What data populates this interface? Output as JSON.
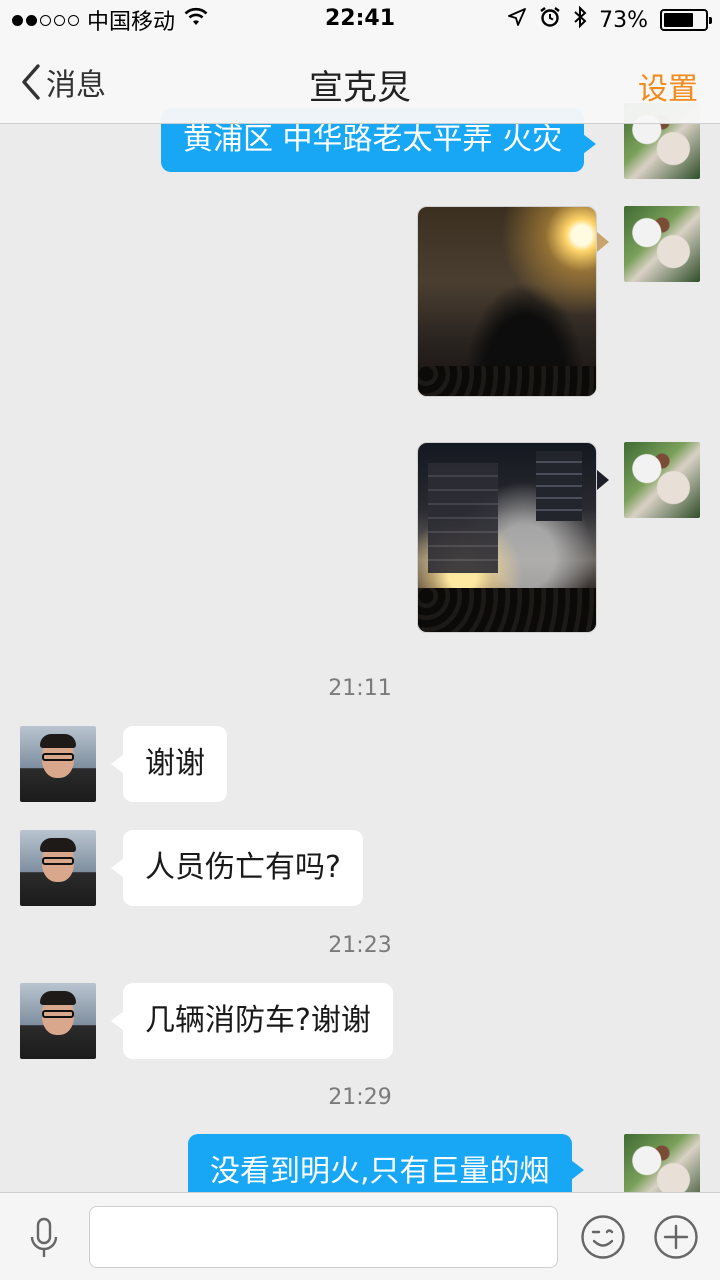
{
  "status_bar": {
    "signal_filled": 2,
    "signal_total": 5,
    "carrier": "中国移动",
    "time": "22:41",
    "battery_text": "73%",
    "battery_level": 0.73
  },
  "nav": {
    "back_label": "消息",
    "title": "宣克炅",
    "right_label": "设置"
  },
  "messages": {
    "out_top": "黄浦区 中华路老太平弄  火灾",
    "time_1": "21:11",
    "in_1": "谢谢",
    "in_2": "人员伤亡有吗?",
    "time_2": "21:23",
    "in_3": "几辆消防车?谢谢",
    "time_3": "21:29",
    "out_bottom": "没看到明火,只有巨量的烟"
  },
  "input": {
    "value": "",
    "placeholder": ""
  },
  "colors": {
    "accent_orange": "#f28a1c",
    "outgoing_bubble": "#18a7f5",
    "incoming_bubble": "#ffffff",
    "background": "#ebebeb"
  },
  "icons": [
    "wifi-icon",
    "location-icon",
    "alarm-icon",
    "bluetooth-icon",
    "battery-icon",
    "back-chevron-icon",
    "microphone-icon",
    "emoji-icon",
    "plus-icon"
  ]
}
